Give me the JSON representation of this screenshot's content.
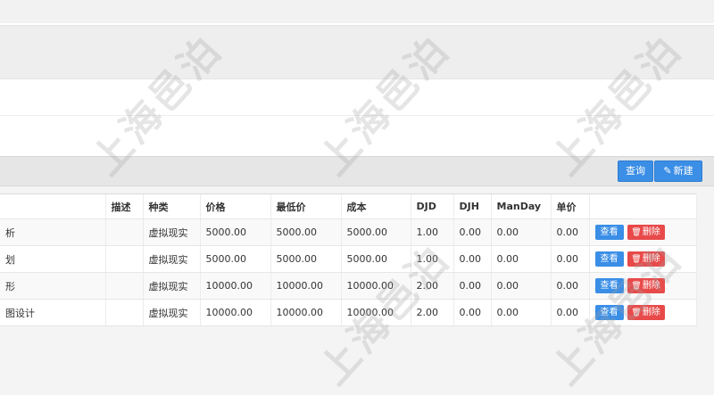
{
  "toolbar": {
    "query_label": "查询",
    "new_label": "新建"
  },
  "table": {
    "columns": [
      "",
      "描述",
      "种类",
      "价格",
      "最低价",
      "成本",
      "DJD",
      "DJH",
      "ManDay",
      "单价",
      ""
    ],
    "rows": [
      {
        "name": "析",
        "desc": "",
        "kind": "虚拟现实",
        "price": "5000.00",
        "min_price": "5000.00",
        "cost": "5000.00",
        "djd": "1.00",
        "djh": "0.00",
        "manday": "0.00",
        "unit_price": "0.00"
      },
      {
        "name": "划",
        "desc": "",
        "kind": "虚拟现实",
        "price": "5000.00",
        "min_price": "5000.00",
        "cost": "5000.00",
        "djd": "1.00",
        "djh": "0.00",
        "manday": "0.00",
        "unit_price": "0.00"
      },
      {
        "name": "形",
        "desc": "",
        "kind": "虚拟现实",
        "price": "10000.00",
        "min_price": "10000.00",
        "cost": "10000.00",
        "djd": "2.00",
        "djh": "0.00",
        "manday": "0.00",
        "unit_price": "0.00"
      },
      {
        "name": "图设计",
        "desc": "",
        "kind": "虚拟现实",
        "price": "10000.00",
        "min_price": "10000.00",
        "cost": "10000.00",
        "djd": "2.00",
        "djh": "0.00",
        "manday": "0.00",
        "unit_price": "0.00"
      }
    ],
    "view_label": "查看",
    "delete_label": "删除"
  },
  "icons": {
    "new": "pencil-icon",
    "delete": "trash-icon"
  },
  "colors": {
    "primary": "#3a8ee6",
    "danger": "#e84a4a"
  },
  "watermark": "上海邑泊"
}
